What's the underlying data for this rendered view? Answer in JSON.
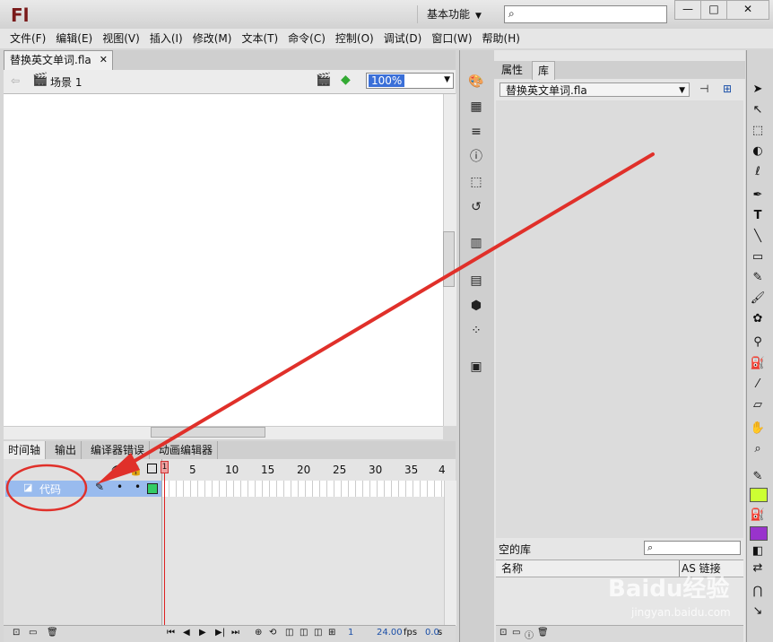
{
  "app": {
    "logo": "Fl",
    "workspace": "基本功能",
    "search_placeholder": ""
  },
  "window_controls": {
    "minimize": "—",
    "maximize": "□",
    "close": "✕"
  },
  "menu": [
    "文件(F)",
    "编辑(E)",
    "视图(V)",
    "插入(I)",
    "修改(M)",
    "文本(T)",
    "命令(C)",
    "控制(O)",
    "调试(D)",
    "窗口(W)",
    "帮助(H)"
  ],
  "document": {
    "tab_title": "替换英文单词.fla",
    "scene": "场景 1",
    "zoom": "100%"
  },
  "timeline": {
    "tabs": [
      "时间轴",
      "输出",
      "编译器错误",
      "动画编辑器"
    ],
    "frame_numbers": [
      "1",
      "5",
      "10",
      "15",
      "20",
      "25",
      "30",
      "35",
      "4"
    ],
    "layer_name": "代码",
    "current_frame": "1",
    "fps": "24.00",
    "fps_unit": "fps",
    "time": "0.0",
    "time_unit": "s"
  },
  "right_panel": {
    "tabs": [
      "属性",
      "库"
    ],
    "library_file": "替换英文单词.fla",
    "empty_label": "空的库",
    "col_name": "名称",
    "col_link": "AS 链接"
  },
  "colors": {
    "stroke": "#ccff33",
    "fill": "#9933cc",
    "annotation": "#e0302a"
  },
  "watermark": {
    "brand": "Baidu经验",
    "url": "jingyan.baidu.com"
  }
}
